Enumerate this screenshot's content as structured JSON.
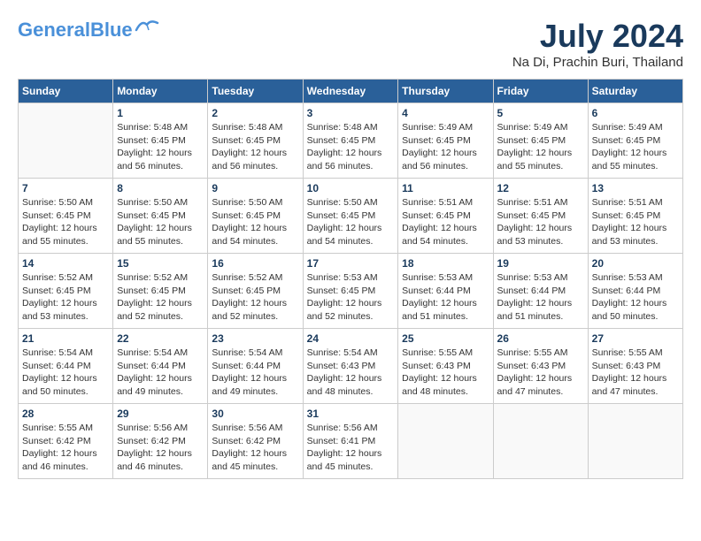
{
  "header": {
    "logo_line1": "General",
    "logo_line2": "Blue",
    "month_year": "July 2024",
    "location": "Na Di, Prachin Buri, Thailand"
  },
  "weekdays": [
    "Sunday",
    "Monday",
    "Tuesday",
    "Wednesday",
    "Thursday",
    "Friday",
    "Saturday"
  ],
  "weeks": [
    [
      {
        "day": "",
        "info": ""
      },
      {
        "day": "1",
        "info": "Sunrise: 5:48 AM\nSunset: 6:45 PM\nDaylight: 12 hours\nand 56 minutes."
      },
      {
        "day": "2",
        "info": "Sunrise: 5:48 AM\nSunset: 6:45 PM\nDaylight: 12 hours\nand 56 minutes."
      },
      {
        "day": "3",
        "info": "Sunrise: 5:48 AM\nSunset: 6:45 PM\nDaylight: 12 hours\nand 56 minutes."
      },
      {
        "day": "4",
        "info": "Sunrise: 5:49 AM\nSunset: 6:45 PM\nDaylight: 12 hours\nand 56 minutes."
      },
      {
        "day": "5",
        "info": "Sunrise: 5:49 AM\nSunset: 6:45 PM\nDaylight: 12 hours\nand 55 minutes."
      },
      {
        "day": "6",
        "info": "Sunrise: 5:49 AM\nSunset: 6:45 PM\nDaylight: 12 hours\nand 55 minutes."
      }
    ],
    [
      {
        "day": "7",
        "info": "Sunrise: 5:50 AM\nSunset: 6:45 PM\nDaylight: 12 hours\nand 55 minutes."
      },
      {
        "day": "8",
        "info": "Sunrise: 5:50 AM\nSunset: 6:45 PM\nDaylight: 12 hours\nand 55 minutes."
      },
      {
        "day": "9",
        "info": "Sunrise: 5:50 AM\nSunset: 6:45 PM\nDaylight: 12 hours\nand 54 minutes."
      },
      {
        "day": "10",
        "info": "Sunrise: 5:50 AM\nSunset: 6:45 PM\nDaylight: 12 hours\nand 54 minutes."
      },
      {
        "day": "11",
        "info": "Sunrise: 5:51 AM\nSunset: 6:45 PM\nDaylight: 12 hours\nand 54 minutes."
      },
      {
        "day": "12",
        "info": "Sunrise: 5:51 AM\nSunset: 6:45 PM\nDaylight: 12 hours\nand 53 minutes."
      },
      {
        "day": "13",
        "info": "Sunrise: 5:51 AM\nSunset: 6:45 PM\nDaylight: 12 hours\nand 53 minutes."
      }
    ],
    [
      {
        "day": "14",
        "info": "Sunrise: 5:52 AM\nSunset: 6:45 PM\nDaylight: 12 hours\nand 53 minutes."
      },
      {
        "day": "15",
        "info": "Sunrise: 5:52 AM\nSunset: 6:45 PM\nDaylight: 12 hours\nand 52 minutes."
      },
      {
        "day": "16",
        "info": "Sunrise: 5:52 AM\nSunset: 6:45 PM\nDaylight: 12 hours\nand 52 minutes."
      },
      {
        "day": "17",
        "info": "Sunrise: 5:53 AM\nSunset: 6:45 PM\nDaylight: 12 hours\nand 52 minutes."
      },
      {
        "day": "18",
        "info": "Sunrise: 5:53 AM\nSunset: 6:44 PM\nDaylight: 12 hours\nand 51 minutes."
      },
      {
        "day": "19",
        "info": "Sunrise: 5:53 AM\nSunset: 6:44 PM\nDaylight: 12 hours\nand 51 minutes."
      },
      {
        "day": "20",
        "info": "Sunrise: 5:53 AM\nSunset: 6:44 PM\nDaylight: 12 hours\nand 50 minutes."
      }
    ],
    [
      {
        "day": "21",
        "info": "Sunrise: 5:54 AM\nSunset: 6:44 PM\nDaylight: 12 hours\nand 50 minutes."
      },
      {
        "day": "22",
        "info": "Sunrise: 5:54 AM\nSunset: 6:44 PM\nDaylight: 12 hours\nand 49 minutes."
      },
      {
        "day": "23",
        "info": "Sunrise: 5:54 AM\nSunset: 6:44 PM\nDaylight: 12 hours\nand 49 minutes."
      },
      {
        "day": "24",
        "info": "Sunrise: 5:54 AM\nSunset: 6:43 PM\nDaylight: 12 hours\nand 48 minutes."
      },
      {
        "day": "25",
        "info": "Sunrise: 5:55 AM\nSunset: 6:43 PM\nDaylight: 12 hours\nand 48 minutes."
      },
      {
        "day": "26",
        "info": "Sunrise: 5:55 AM\nSunset: 6:43 PM\nDaylight: 12 hours\nand 47 minutes."
      },
      {
        "day": "27",
        "info": "Sunrise: 5:55 AM\nSunset: 6:43 PM\nDaylight: 12 hours\nand 47 minutes."
      }
    ],
    [
      {
        "day": "28",
        "info": "Sunrise: 5:55 AM\nSunset: 6:42 PM\nDaylight: 12 hours\nand 46 minutes."
      },
      {
        "day": "29",
        "info": "Sunrise: 5:56 AM\nSunset: 6:42 PM\nDaylight: 12 hours\nand 46 minutes."
      },
      {
        "day": "30",
        "info": "Sunrise: 5:56 AM\nSunset: 6:42 PM\nDaylight: 12 hours\nand 45 minutes."
      },
      {
        "day": "31",
        "info": "Sunrise: 5:56 AM\nSunset: 6:41 PM\nDaylight: 12 hours\nand 45 minutes."
      },
      {
        "day": "",
        "info": ""
      },
      {
        "day": "",
        "info": ""
      },
      {
        "day": "",
        "info": ""
      }
    ]
  ]
}
